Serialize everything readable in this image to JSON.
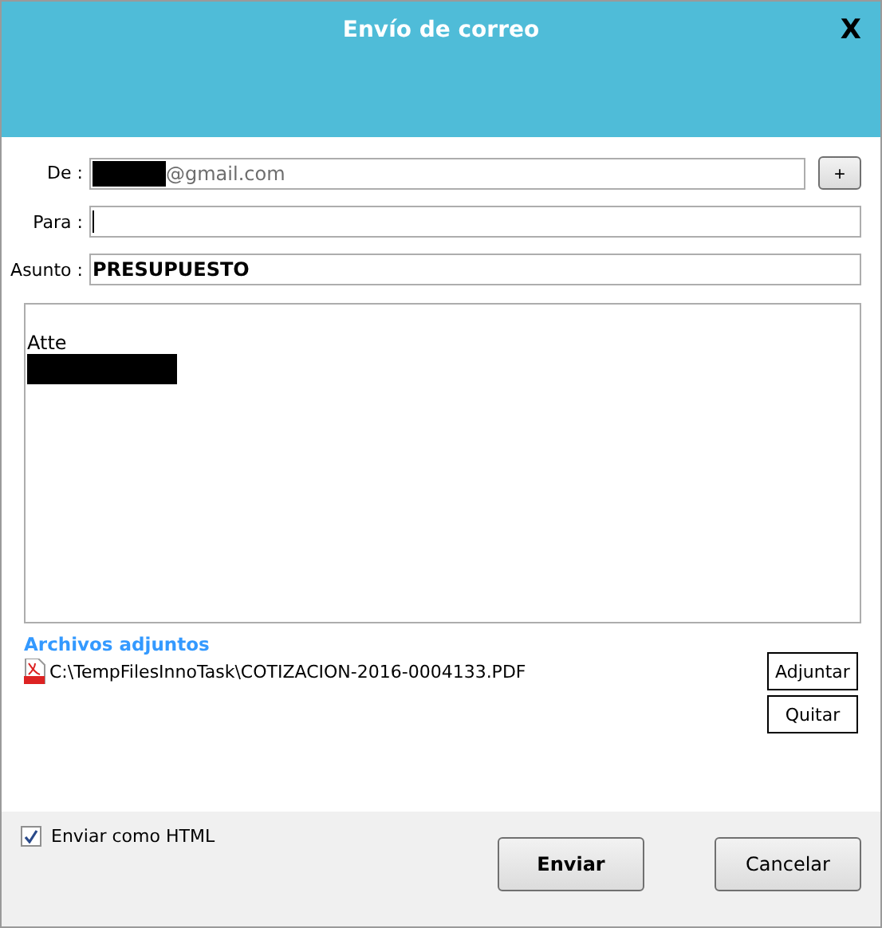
{
  "window": {
    "title": "Envío de correo",
    "close": "X"
  },
  "fields": [
    {
      "label": "De :",
      "value": "@gmail.com",
      "redacted": true,
      "disabled": true,
      "button": "+"
    },
    {
      "label": "Para :",
      "focused": true
    },
    {
      "label": "Asunto :",
      "value": "PRESUPUESTO",
      "bold": true
    }
  ],
  "body": {
    "text": "Atte",
    "redacted": true
  },
  "attachments": {
    "title": "Archivos adjuntos",
    "files": [
      "C:\\TempFilesInnoTask\\COTIZACION-2016-0004133.PDF"
    ],
    "buttons": [
      "Adjuntar",
      "Quitar"
    ]
  },
  "footer": {
    "html_checkbox": {
      "label": "Enviar como HTML",
      "checked": true
    },
    "buttons": [
      {
        "label": "Enviar",
        "bold": true
      },
      {
        "label": "Cancelar",
        "bold": false
      }
    ]
  }
}
